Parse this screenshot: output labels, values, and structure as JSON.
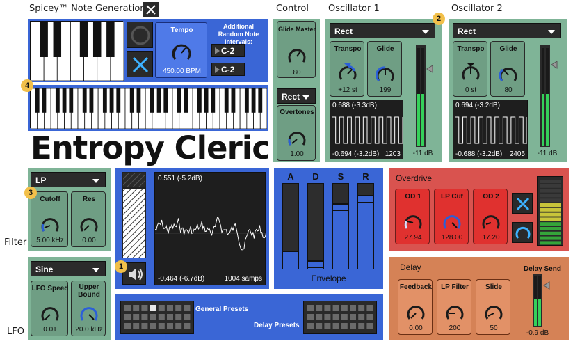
{
  "note_generation": {
    "title": "Spicey™ Note Generation",
    "tempo_label": "Tempo",
    "tempo_value": "450.00 BPM",
    "additional_label": "Additional Random Note Intervals:",
    "interval_1": "C-2",
    "interval_2": "C-2"
  },
  "device_name": "Entropy Cleric",
  "control": {
    "title": "Control",
    "glide_master_label": "Glide Master",
    "glide_master_value": "80",
    "waveform": "Rect",
    "overtones_label": "Overtones",
    "overtones_value": "1.00"
  },
  "osc1": {
    "title": "Oscillator 1",
    "waveform": "Rect",
    "transpo_label": "Transpo",
    "transpo_value": "+12 st",
    "glide_label": "Glide",
    "glide_value": "199",
    "scope_top": "0.688 (-3.3dB)",
    "scope_bottom": "-0.694 (-3.2dB)",
    "scope_samples": "1203",
    "meter_value": "-11 dB"
  },
  "osc2": {
    "title": "Oscillator 2",
    "waveform": "Rect",
    "transpo_label": "Transpo",
    "transpo_value": "0 st",
    "glide_label": "Glide",
    "glide_value": "80",
    "scope_top": "0.694 (-3.2dB)",
    "scope_bottom": "-0.688 (-3.2dB)",
    "scope_samples": "2405",
    "meter_value": "-11 dB"
  },
  "filter": {
    "title": "Filter",
    "type": "LP",
    "cutoff_label": "Cutoff",
    "cutoff_value": "5.00 kHz",
    "res_label": "Res",
    "res_value": "0.00"
  },
  "lfo": {
    "title": "LFO",
    "waveform": "Sine",
    "speed_label": "LFO Speed",
    "speed_value": "0.01",
    "upper_label": "Upper Bound",
    "upper_value": "20.0 kHz"
  },
  "main_scope": {
    "top": "0.551 (-5.2dB)",
    "bottom": "-0.464 (-6.7dB)",
    "samples": "1004 samps"
  },
  "envelope": {
    "title": "Envelope",
    "labels": [
      "A",
      "D",
      "S",
      "R"
    ]
  },
  "overdrive": {
    "title": "Overdrive",
    "od1_label": "OD 1",
    "od1_value": "27.94",
    "lpcut_label": "LP Cut",
    "lpcut_value": "128.00",
    "od2_label": "OD 2",
    "od2_value": "17.20"
  },
  "delay": {
    "title": "Delay",
    "feedback_label": "Feedback",
    "feedback_value": "0.00",
    "lpfilter_label": "LP Filter",
    "lpfilter_value": "200",
    "slide_label": "Slide",
    "slide_value": "50",
    "send_label": "Delay Send",
    "send_value": "-0.9 dB"
  },
  "presets": {
    "general_label": "General Presets",
    "delay_label": "Delay Presets"
  },
  "badges": [
    "1",
    "2",
    "3",
    "4"
  ],
  "colors": {
    "accent_blue": "#3a66d6",
    "panel_green": "#7fb497",
    "overdrive_red": "#d9534f",
    "delay_orange": "#d58256"
  }
}
